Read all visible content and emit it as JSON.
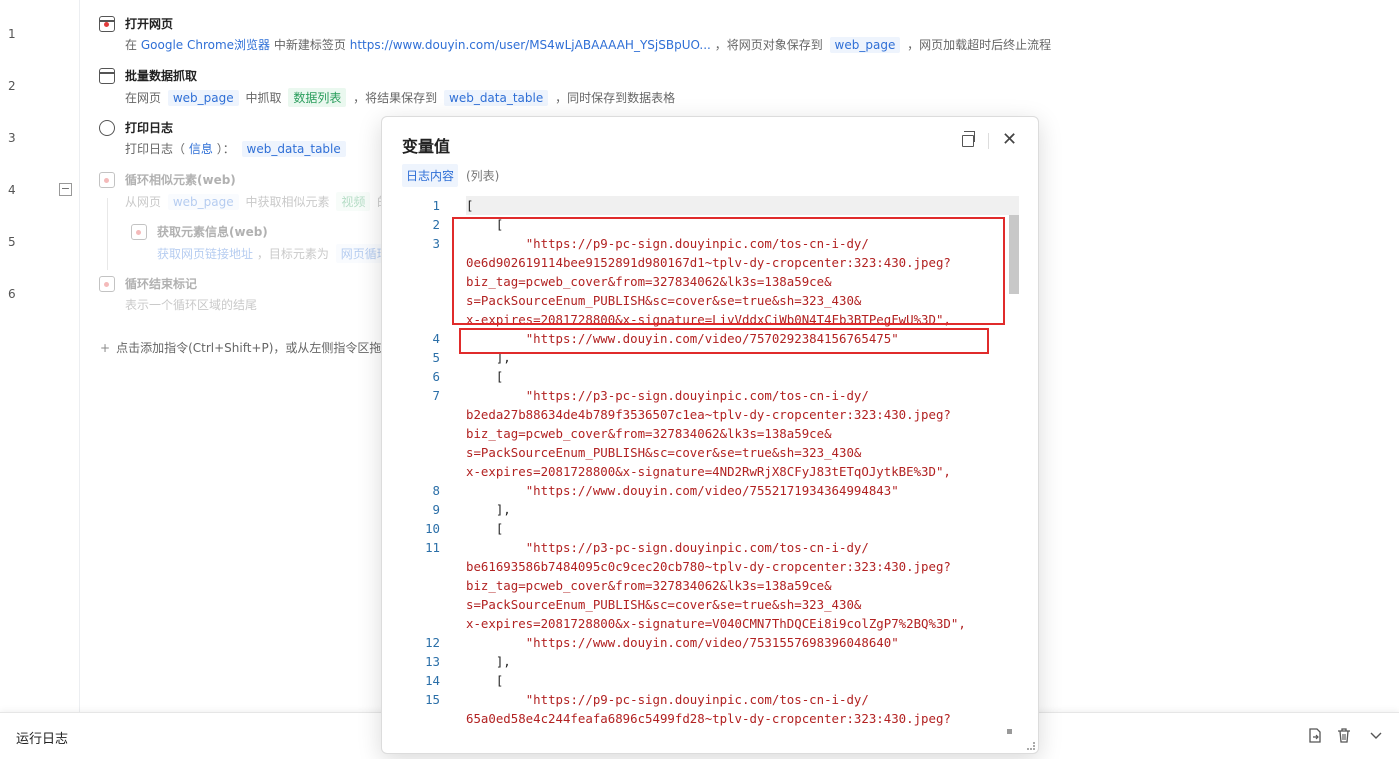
{
  "editor": {
    "line_numbers": [
      "1",
      "2",
      "3",
      "4",
      "5",
      "6"
    ],
    "collapse_symbol": "−",
    "steps": [
      {
        "title": "打开网页",
        "desc_prefix": "在",
        "browser": "Google Chrome浏览器",
        "desc_mid": "中新建标签页",
        "url": "https://www.douyin.com/user/MS4wLjABAAAAH_YSjSBpUO...",
        "desc_mid2": "，将网页对象保存到",
        "var": "web_page",
        "desc_suffix": "，网页加载超时后终止流程"
      },
      {
        "title": "批量数据抓取",
        "desc_prefix": "在网页",
        "var": "web_page",
        "desc_mid": "中抓取",
        "green_tag": "数据列表",
        "desc_mid2": "，将结果保存到",
        "var2": "web_data_table",
        "desc_suffix": "，同时保存到数据表格"
      },
      {
        "title": "打印日志",
        "desc_prefix": "打印日志（",
        "level": "信息",
        "desc_mid": "）：",
        "var": "web_data_table"
      },
      {
        "title": "循环相似元素(web)",
        "desc_prefix": "从网页",
        "var": "web_page",
        "desc_mid": "中获取相似元素",
        "green_tag": "视频",
        "desc_suffix": "的链"
      },
      {
        "title": "获取元素信息(web)",
        "desc_prefix": "获取网页链接地址",
        "desc_mid": "，目标元素为",
        "var": "网页循环"
      },
      {
        "title": "循环结束标记",
        "desc_prefix": "表示一个循环区域的结尾"
      }
    ],
    "add_hint_plus": "+",
    "add_hint": "点击添加指令(Ctrl+Shift+P)，或从左侧指令区拖入"
  },
  "run_log": {
    "label": "运行日志",
    "icons": [
      "export-icon",
      "trash-icon",
      "chevron-down-icon"
    ]
  },
  "modal": {
    "title": "变量值",
    "tab_label": "日志内容",
    "type_label": "(列表)",
    "code_lines": [
      {
        "n": "1",
        "t": "["
      },
      {
        "n": "2",
        "t": "    ["
      },
      {
        "n": "3",
        "t": "        \"https://p9-pc-sign.douyinpic.com/tos-cn-i-dy/"
      },
      {
        "n": "",
        "t": "0e6d902619114bee9152891d980167d1~tplv-dy-cropcenter:323:430.jpeg?"
      },
      {
        "n": "",
        "t": "biz_tag=pcweb_cover&from=327834062&lk3s=138a59ce&"
      },
      {
        "n": "",
        "t": "s=PackSourceEnum_PUBLISH&sc=cover&se=true&sh=323_430&"
      },
      {
        "n": "",
        "t": "x-expires=2081728800&x-signature=LivVddxCiWb0N4T4Fb3BTPegFwU%3D\","
      },
      {
        "n": "4",
        "t": "        \"https://www.douyin.com/video/7570292384156765475\""
      },
      {
        "n": "5",
        "t": "    ],"
      },
      {
        "n": "6",
        "t": "    ["
      },
      {
        "n": "7",
        "t": "        \"https://p3-pc-sign.douyinpic.com/tos-cn-i-dy/"
      },
      {
        "n": "",
        "t": "b2eda27b88634de4b789f3536507c1ea~tplv-dy-cropcenter:323:430.jpeg?"
      },
      {
        "n": "",
        "t": "biz_tag=pcweb_cover&from=327834062&lk3s=138a59ce&"
      },
      {
        "n": "",
        "t": "s=PackSourceEnum_PUBLISH&sc=cover&se=true&sh=323_430&"
      },
      {
        "n": "",
        "t": "x-expires=2081728800&x-signature=4ND2RwRjX8CFyJ83tETqOJytkBE%3D\","
      },
      {
        "n": "8",
        "t": "        \"https://www.douyin.com/video/7552171934364994843\""
      },
      {
        "n": "9",
        "t": "    ],"
      },
      {
        "n": "10",
        "t": "    ["
      },
      {
        "n": "11",
        "t": "        \"https://p3-pc-sign.douyinpic.com/tos-cn-i-dy/"
      },
      {
        "n": "",
        "t": "be61693586b7484095c0c9cec20cb780~tplv-dy-cropcenter:323:430.jpeg?"
      },
      {
        "n": "",
        "t": "biz_tag=pcweb_cover&from=327834062&lk3s=138a59ce&"
      },
      {
        "n": "",
        "t": "s=PackSourceEnum_PUBLISH&sc=cover&se=true&sh=323_430&"
      },
      {
        "n": "",
        "t": "x-expires=2081728800&x-signature=V040CMN7ThDQCEi8i9colZgP7%2BQ%3D\","
      },
      {
        "n": "12",
        "t": "        \"https://www.douyin.com/video/7531557698396048640\""
      },
      {
        "n": "13",
        "t": "    ],"
      },
      {
        "n": "14",
        "t": "    ["
      },
      {
        "n": "15",
        "t": "        \"https://p9-pc-sign.douyinpic.com/tos-cn-i-dy/"
      },
      {
        "n": "",
        "t": "65a0ed58e4c244feafa6896c5499fd28~tplv-dy-cropcenter:323:430.jpeg?"
      }
    ]
  },
  "colors": {
    "accent": "#2f6fd6",
    "highlight_box": "#e02b2b",
    "string": "#b22222",
    "green_tag": "#2a9d5c"
  }
}
